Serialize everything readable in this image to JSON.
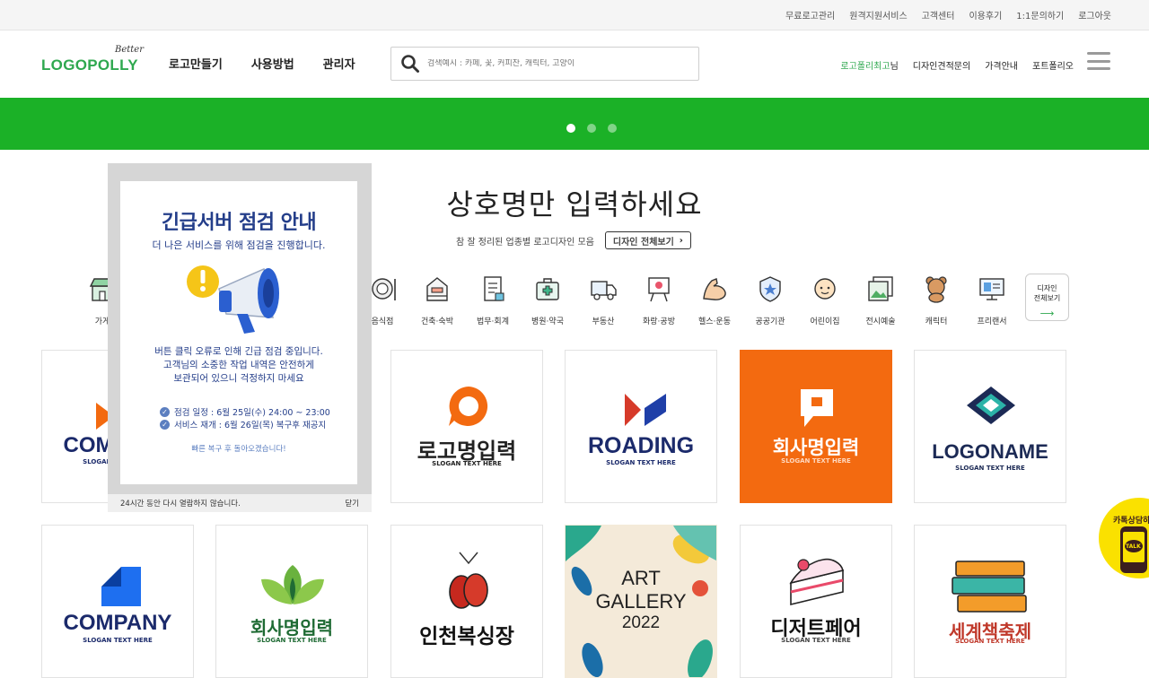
{
  "topbar": {
    "links": [
      "무료로고관리",
      "원격지원서비스",
      "고객센터",
      "이용후기",
      "1:1문의하기",
      "로그아웃"
    ]
  },
  "logo": {
    "tag": "Better",
    "word": "LOGOPOLLY"
  },
  "mainnav": [
    "로고만들기",
    "사용방법",
    "관리자"
  ],
  "search": {
    "placeholder": "검색예시 : 카페, 꽃, 커피잔, 캐릭터, 고양이"
  },
  "rightnav": {
    "user_name": "로고폴리최고",
    "user_suffix": "님",
    "items": [
      "디자인견적문의",
      "가격안내",
      "포트폴리오"
    ]
  },
  "banner": {
    "color": "#1bb127",
    "slides": 3,
    "active": 0
  },
  "hero": {
    "heading": "상호명만 입력하세요",
    "sub": "참 잘 정리된 업종별 로고디자인 모음",
    "all_button": "디자인 전체보기",
    "all_arrow": "›"
  },
  "categories": [
    {
      "label": "가게",
      "icon": "shop-icon"
    },
    {
      "label": "음식점",
      "icon": "dining-icon"
    },
    {
      "label": "건축·숙박",
      "icon": "building-icon"
    },
    {
      "label": "법무·회계",
      "icon": "document-icon"
    },
    {
      "label": "병원·약국",
      "icon": "medical-kit-icon"
    },
    {
      "label": "부동산",
      "icon": "truck-icon"
    },
    {
      "label": "화랑·공방",
      "icon": "easel-icon"
    },
    {
      "label": "헬스·운동",
      "icon": "muscle-icon"
    },
    {
      "label": "공공기관",
      "icon": "badge-icon"
    },
    {
      "label": "어린이집",
      "icon": "baby-icon"
    },
    {
      "label": "전시예술",
      "icon": "gallery-icon"
    },
    {
      "label": "캐릭터",
      "icon": "bear-icon"
    },
    {
      "label": "프리랜서",
      "icon": "monitor-icon"
    }
  ],
  "all_designs_button": {
    "line1": "디자인",
    "line2": "전체보기",
    "arrow": "⟶"
  },
  "logos": [
    {
      "title": "COMPANY",
      "slogan": "SLOGAN TEXT HERE"
    },
    {
      "title": "로고명입력",
      "slogan": "SLOGAN TEXT HERE"
    },
    {
      "title": "ROADING",
      "slogan": "SLOGAN TEXT HERE"
    },
    {
      "title": "회사명입력",
      "slogan": "SLOGAN TEXT HERE"
    },
    {
      "title": "LOGONAME",
      "slogan": "SLOGAN TEXT HERE"
    },
    {
      "title": "COMPANY",
      "slogan": "SLOGAN TEXT HERE"
    },
    {
      "title": "회사명입력",
      "slogan": "SLOGAN TEXT HERE"
    },
    {
      "title": "인천복싱장",
      "slogan": ""
    },
    {
      "title": "ART",
      "title2": "GALLERY",
      "title3": "2022",
      "slogan": ""
    },
    {
      "title": "디저트페어",
      "slogan": "SLOGAN TEXT HERE"
    },
    {
      "title": "세계책축제",
      "slogan": "SLOGAN TEXT HERE"
    }
  ],
  "popup": {
    "title": "긴급서버 점검 안내",
    "subtitle": "더 나은 서비스를 위해 점검을 진행합니다.",
    "body1": "버튼 클릭 오류로 인해 긴급 점검 중입니다.",
    "body2": "고객님의 소중한 작업 내역은 안전하게",
    "body3": "보관되어 있으니 걱정하지 마세요",
    "schedule": "점검 일정 : 6월 25일(수) 24:00 ~ 23:00",
    "resume": "서비스 재개 : 6월 26일(목) 복구후 재공지",
    "footer": "빠른 복구 후 돌아오겠습니다!",
    "hide_24h": "24시간 동안 다시 열람하지 않습니다.",
    "close": "닫기"
  },
  "kakao": {
    "label": "카톡상담하기",
    "talk": "TALK"
  },
  "colors": {
    "brand_green": "#2fa84f",
    "banner_green": "#1bb127",
    "orange": "#f36a10",
    "navy": "#1b2a6b"
  }
}
